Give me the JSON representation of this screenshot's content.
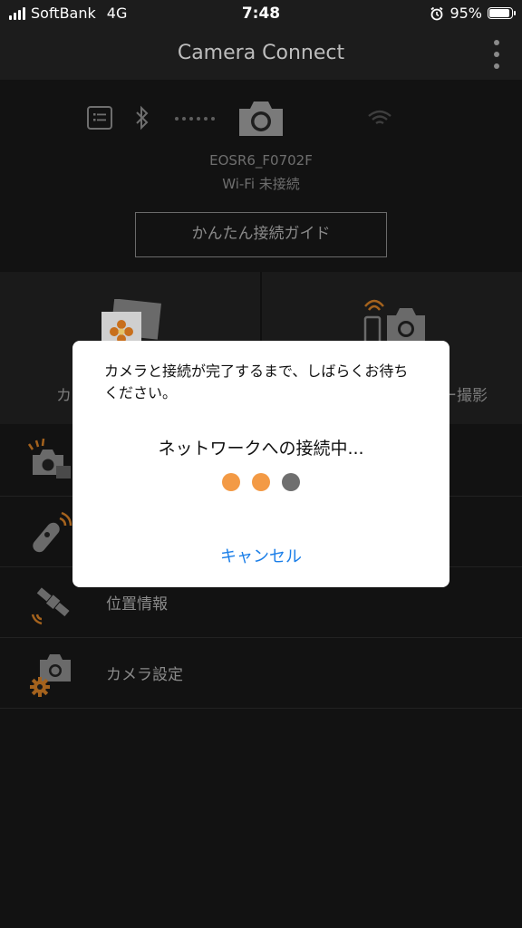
{
  "status_bar": {
    "carrier": "SoftBank",
    "network": "4G",
    "time": "7:48",
    "battery_percent": "95%",
    "battery_level": 0.95
  },
  "header": {
    "title": "Camera Connect",
    "menu_icon": "more-vertical-icon"
  },
  "connection": {
    "camera_name": "EOSR6_F0702F",
    "wifi_status": "Wi-Fi 未接続",
    "guide_button_label": "かんたん接続ガイド",
    "icons": [
      "list-icon",
      "bluetooth-icon",
      "camera-icon",
      "wifi-icon"
    ]
  },
  "tiles": [
    {
      "label_visible": "カ",
      "icon": "images-on-camera-icon"
    },
    {
      "label_visible": "ー撮影",
      "icon": "remote-shooting-icon"
    }
  ],
  "list": [
    {
      "label": "",
      "icon": "camera-auto-transfer-icon"
    },
    {
      "label": "",
      "icon": "bluetooth-remote-icon"
    },
    {
      "label": "位置情報",
      "icon": "satellite-icon"
    },
    {
      "label": "カメラ設定",
      "icon": "camera-settings-icon"
    }
  ],
  "dialog": {
    "message": "カメラと接続が完了するまで、しばらくお待ちください。",
    "progress_text": "ネットワークへの接続中...",
    "cancel_label": "キャンセル",
    "dot_colors": [
      "#f39a45",
      "#f39a45",
      "#6f6f6f"
    ]
  },
  "colors": {
    "accent_orange": "#f39a45",
    "link_blue": "#1a7ee8",
    "background": "#121212"
  }
}
